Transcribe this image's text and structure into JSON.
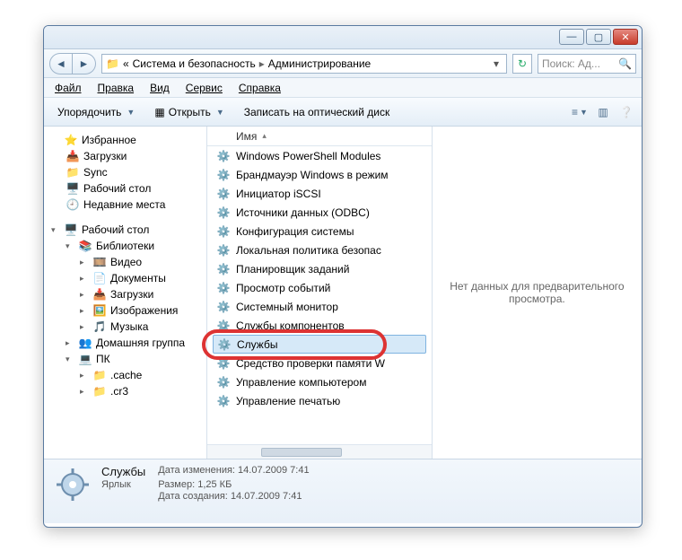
{
  "breadcrumb": {
    "prefix": "«",
    "level1": "Система и безопасность",
    "level2": "Администрирование"
  },
  "search": {
    "placeholder": "Поиск: Ад..."
  },
  "menubar": {
    "file": "Файл",
    "edit": "Правка",
    "view": "Вид",
    "tools": "Сервис",
    "help": "Справка"
  },
  "toolbar": {
    "organize": "Упорядочить",
    "open": "Открыть",
    "burn": "Записать на оптический диск"
  },
  "nav": {
    "favorites": {
      "label": "Избранное",
      "items": [
        "Загрузки",
        "Sync",
        "Рабочий стол",
        "Недавние места"
      ]
    },
    "desktop": {
      "label": "Рабочий стол",
      "libraries": {
        "label": "Библиотеки",
        "items": [
          "Видео",
          "Документы",
          "Загрузки",
          "Изображения",
          "Музыка"
        ]
      },
      "homegroup": "Домашняя группа",
      "pc": {
        "label": "ПК",
        "items": [
          ".cache",
          ".cr3"
        ]
      }
    }
  },
  "list": {
    "column_name": "Имя",
    "items": [
      "Windows PowerShell Modules",
      "Брандмауэр Windows в режим",
      "Инициатор iSCSI",
      "Источники данных (ODBC)",
      "Конфигурация системы",
      "Локальная политика безопас",
      "Планировщик заданий",
      "Просмотр событий",
      "Системный монитор",
      "Службы компонентов",
      "Службы",
      "Средство проверки памяти W",
      "Управление компьютером",
      "Управление печатью"
    ],
    "selected_index": 10
  },
  "preview": {
    "empty": "Нет данных для предварительного просмотра."
  },
  "details": {
    "name": "Службы",
    "type": "Ярлык",
    "modified_label": "Дата изменения:",
    "modified_value": "14.07.2009 7:41",
    "size_label": "Размер:",
    "size_value": "1,25 КБ",
    "created_label": "Дата создания:",
    "created_value": "14.07.2009 7:41"
  }
}
